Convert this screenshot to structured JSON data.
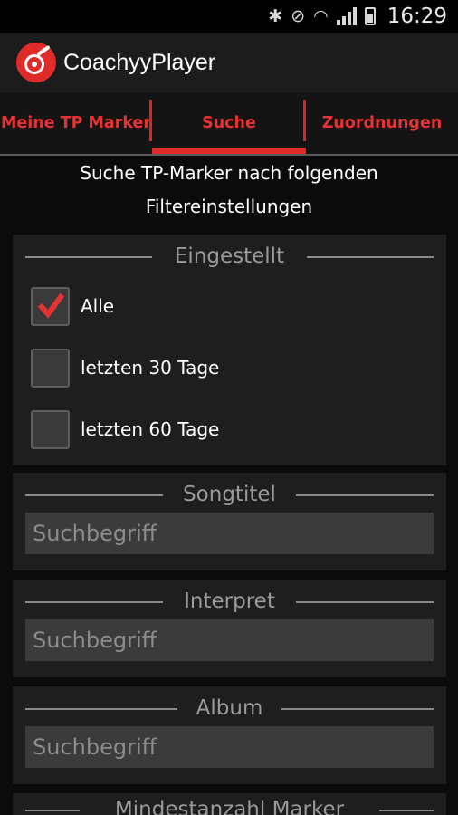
{
  "status_bar": {
    "time": "16:29",
    "icons": [
      "bluetooth-icon",
      "mute-icon",
      "wifi-icon",
      "signal-icon",
      "battery-icon"
    ]
  },
  "app": {
    "title": "CoachyyPlayer",
    "logo_icon": "vinyl-record-icon",
    "accent_color": "#e12a2a"
  },
  "tabs": [
    {
      "label": "Meine TP Marker",
      "active": false
    },
    {
      "label": "Suche",
      "active": true
    },
    {
      "label": "Zuordnungen",
      "active": false
    }
  ],
  "heading": {
    "line1": "Suche TP-Marker nach folgenden",
    "line2": "Filtereinstellungen"
  },
  "filters": {
    "eingestellt": {
      "title": "Eingestellt",
      "options": [
        {
          "label": "Alle",
          "checked": true
        },
        {
          "label": "letzten 30 Tage",
          "checked": false
        },
        {
          "label": "letzten 60 Tage",
          "checked": false
        }
      ]
    },
    "songtitel": {
      "title": "Songtitel",
      "placeholder": "Suchbegriff"
    },
    "interpret": {
      "title": "Interpret",
      "placeholder": "Suchbegriff"
    },
    "album": {
      "title": "Album",
      "placeholder": "Suchbegriff"
    },
    "mindestanzahl": {
      "title": "Mindestanzahl Marker"
    }
  }
}
